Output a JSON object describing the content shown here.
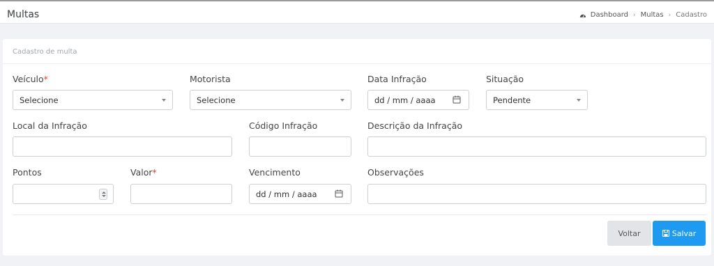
{
  "header": {
    "title": "Multas",
    "breadcrumb": {
      "dashboard": "Dashboard",
      "multas": "Multas",
      "cadastro": "Cadastro",
      "separator": "›"
    }
  },
  "card": {
    "title": "Cadastro de multa"
  },
  "form": {
    "veiculo": {
      "label": "Veículo",
      "required": "*",
      "value": "Selecione"
    },
    "motorista": {
      "label": "Motorista",
      "value": "Selecione"
    },
    "data_infracao": {
      "label": "Data Infração",
      "placeholder": "dd / mm / aaaa"
    },
    "situacao": {
      "label": "Situação",
      "value": "Pendente"
    },
    "local_infracao": {
      "label": "Local da Infração",
      "value": ""
    },
    "codigo_infracao": {
      "label": "Código Infração",
      "value": ""
    },
    "descricao_infracao": {
      "label": "Descrição da Infração",
      "value": ""
    },
    "pontos": {
      "label": "Pontos",
      "value": ""
    },
    "valor": {
      "label": "Valor",
      "required": "*",
      "value": ""
    },
    "vencimento": {
      "label": "Vencimento",
      "placeholder": "dd / mm / aaaa"
    },
    "observacoes": {
      "label": "Observações",
      "value": ""
    }
  },
  "actions": {
    "voltar": "Voltar",
    "salvar": "Salvar"
  },
  "colors": {
    "primary": "#1e9bf0",
    "required": "#e53935",
    "secondary_button": "#e2e4e7"
  },
  "icons": {
    "breadcrumb": "dashboard-icon",
    "date": "calendar-icon",
    "save": "floppy-disk-icon",
    "select": "caret-down-icon"
  }
}
